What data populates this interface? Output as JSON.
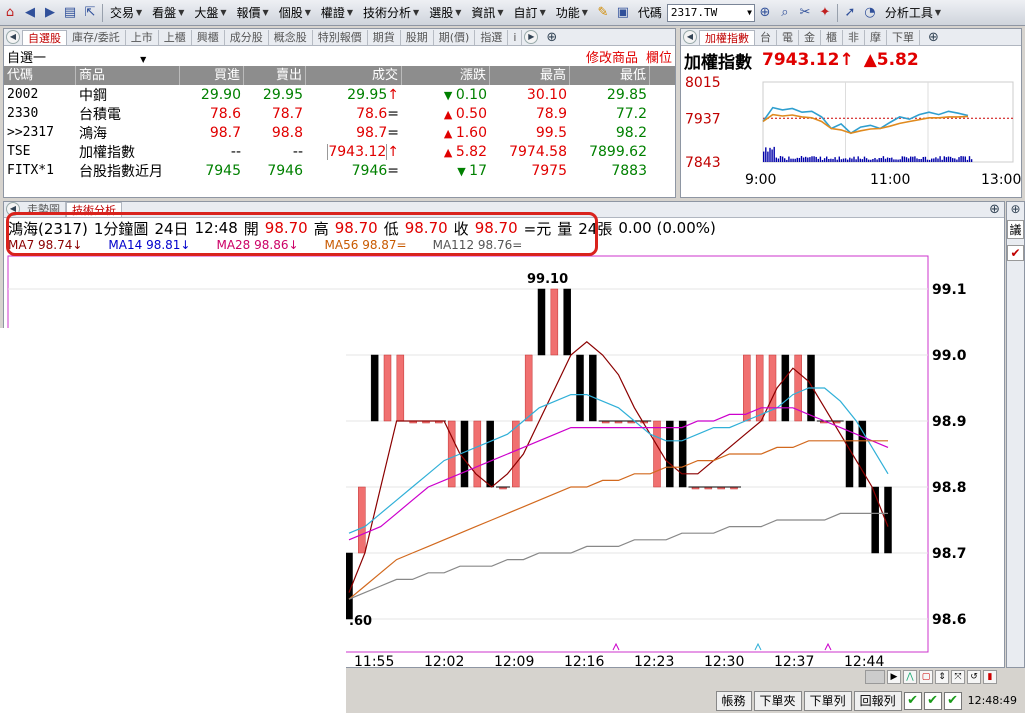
{
  "toolbar": {
    "menus": [
      "交易",
      "看盤",
      "大盤",
      "報價",
      "個股",
      "權證",
      "技術分析",
      "選股",
      "資訊",
      "自訂",
      "功能"
    ],
    "code_label": "代碼",
    "code_value": "2317.TW",
    "analysis_tools": "分析工具"
  },
  "quote_panel": {
    "tabs": [
      "自選股",
      "庫存/委託",
      "上市",
      "上櫃",
      "興櫃",
      "成分股",
      "概念股",
      "特別報價",
      "期貨",
      "股期",
      "期(價)",
      "指選",
      "i"
    ],
    "active_tab": "自選股",
    "list_name": "自選一",
    "modify_label": "修改商品",
    "column_label": "欄位",
    "headers": [
      "代碼",
      "商品",
      "買進",
      "賣出",
      "成交",
      "漲跌",
      "最高",
      "最低"
    ],
    "rows": [
      {
        "code": "2002",
        "name": "中鋼",
        "bid": "29.90",
        "ask": "29.95",
        "last": "29.95",
        "last_mark": "↑",
        "chg": "0.10",
        "dir": "down",
        "hi": "30.10",
        "lo": "29.85"
      },
      {
        "code": "2330",
        "name": "台積電",
        "bid": "78.6",
        "ask": "78.7",
        "last": "78.6",
        "last_mark": "=",
        "chg": "0.50",
        "dir": "up",
        "hi": "78.9",
        "lo": "77.2"
      },
      {
        "code": ">>2317",
        "name": "鴻海",
        "bid": "98.7",
        "ask": "98.8",
        "last": "98.7",
        "last_mark": "=",
        "chg": "1.60",
        "dir": "up",
        "hi": "99.5",
        "lo": "98.2"
      },
      {
        "code": "TSE",
        "name": "加權指數",
        "bid": "--",
        "ask": "--",
        "last": "7943.12",
        "last_mark": "↑",
        "chg": "5.82",
        "dir": "up",
        "hi": "7974.58",
        "lo": "7899.62"
      },
      {
        "code": "FITX*1",
        "name": "台股指數近月",
        "bid": "7945",
        "ask": "7946",
        "last": "7946",
        "last_mark": "=",
        "chg": "17",
        "dir": "down",
        "hi": "7975",
        "lo": "7883"
      }
    ]
  },
  "index_panel": {
    "tabs": [
      "加權指數",
      "台",
      "電",
      "金",
      "櫃",
      "非",
      "摩",
      "下單"
    ],
    "title": "加權指數",
    "value": "7943.12",
    "value_mark": "↑",
    "change": "5.82",
    "change_mark": "▲",
    "y_labels": [
      "8015",
      "7937",
      "7843"
    ],
    "x_labels": [
      "9:00",
      "11:00",
      "13:00"
    ],
    "chart_data": {
      "type": "line",
      "ylim": [
        7843,
        8015
      ],
      "x": [
        "9:00",
        "11:00",
        "13:00"
      ],
      "y_ticks": [
        8015,
        7937,
        7843
      ],
      "series": [
        {
          "color": "#2f9fcf",
          "values": [
            7930,
            7960,
            7955,
            7958,
            7950,
            7952,
            7940,
            7915,
            7925,
            7905,
            7918,
            7922,
            7915,
            7928,
            7940,
            7935,
            7945,
            7950,
            7945,
            7952,
            7948,
            7943
          ]
        },
        {
          "color": "#e08a1e",
          "values": [
            7930,
            7945,
            7942,
            7944,
            7940,
            7938,
            7930,
            7915,
            7912,
            7905,
            7910,
            7914,
            7915,
            7920,
            7926,
            7930,
            7934,
            7938,
            7938,
            7940,
            7940,
            7941
          ]
        }
      ]
    }
  },
  "tech_panel": {
    "tabs": [
      "走勢圖",
      "技術分析"
    ],
    "active_tab": "技術分析",
    "stock": "鴻海(2317)",
    "period": "1分鐘圖",
    "date": "24日",
    "time": "12:48",
    "open_label": "開",
    "open": "98.70",
    "high_label": "高",
    "high": "98.70",
    "low_label": "低",
    "low": "98.70",
    "close_label": "收",
    "close": "98.70",
    "change_text": "=元",
    "volume_label": "量",
    "volume": "24張",
    "change": "0.00 (0.00%)",
    "ma": [
      {
        "label": "MA7 98.74↓",
        "color": "#8b0000"
      },
      {
        "label": "MA14 98.81↓",
        "color": "#0000cc"
      },
      {
        "label": "MA28 98.86↓",
        "color": "#cc0066"
      },
      {
        "label": "MA56 98.87=",
        "color": "#c85a00"
      },
      {
        "label": "MA112 98.76=",
        "color": "#555555"
      }
    ],
    "chart_data": {
      "type": "bar",
      "ylim": [
        98.55,
        99.15
      ],
      "y_ticks": [
        98.6,
        98.7,
        98.8,
        98.9,
        99.0,
        99.1
      ],
      "x_ticks": [
        "11:55",
        "12:02",
        "12:09",
        "12:16",
        "12:23",
        "12:30",
        "12:37",
        "12:44"
      ],
      "high_annotation": "99.10",
      "low_annotation": ".60",
      "candles": [
        {
          "o": 98.6,
          "c": 98.7,
          "up": false
        },
        {
          "o": 98.7,
          "c": 98.8,
          "up": true
        },
        {
          "o": 99.0,
          "c": 98.9,
          "up": false
        },
        {
          "o": 98.9,
          "c": 99.0,
          "up": true
        },
        {
          "o": 98.9,
          "c": 99.0,
          "up": true
        },
        {
          "o": 98.9,
          "c": 98.9,
          "up": true
        },
        {
          "o": 98.9,
          "c": 98.9,
          "up": true
        },
        {
          "o": 98.9,
          "c": 98.9,
          "up": true
        },
        {
          "o": 98.8,
          "c": 98.9,
          "up": true
        },
        {
          "o": 98.9,
          "c": 98.8,
          "up": false
        },
        {
          "o": 98.8,
          "c": 98.9,
          "up": true
        },
        {
          "o": 98.9,
          "c": 98.8,
          "up": false
        },
        {
          "o": 98.8,
          "c": 98.8,
          "up": true
        },
        {
          "o": 98.8,
          "c": 98.9,
          "up": true
        },
        {
          "o": 98.9,
          "c": 99.0,
          "up": true
        },
        {
          "o": 99.0,
          "c": 99.1,
          "up": false
        },
        {
          "o": 99.0,
          "c": 99.1,
          "up": true
        },
        {
          "o": 99.1,
          "c": 99.0,
          "up": false
        },
        {
          "o": 99.0,
          "c": 98.9,
          "up": false
        },
        {
          "o": 98.9,
          "c": 99.0,
          "up": false
        },
        {
          "o": 98.9,
          "c": 98.9,
          "up": true
        },
        {
          "o": 98.9,
          "c": 98.9,
          "up": true
        },
        {
          "o": 98.9,
          "c": 98.9,
          "up": true
        },
        {
          "o": 98.9,
          "c": 98.9,
          "up": true
        },
        {
          "o": 98.8,
          "c": 98.9,
          "up": true
        },
        {
          "o": 98.8,
          "c": 98.9,
          "up": false
        },
        {
          "o": 98.9,
          "c": 98.8,
          "up": false
        },
        {
          "o": 98.8,
          "c": 98.8,
          "up": true
        },
        {
          "o": 98.8,
          "c": 98.8,
          "up": true
        },
        {
          "o": 98.8,
          "c": 98.8,
          "up": true
        },
        {
          "o": 98.8,
          "c": 98.8,
          "up": true
        },
        {
          "o": 98.9,
          "c": 99.0,
          "up": true
        },
        {
          "o": 98.9,
          "c": 99.0,
          "up": true
        },
        {
          "o": 98.9,
          "c": 99.0,
          "up": true
        },
        {
          "o": 98.9,
          "c": 99.0,
          "up": false
        },
        {
          "o": 98.9,
          "c": 99.0,
          "up": true
        },
        {
          "o": 99.0,
          "c": 98.9,
          "up": false
        },
        {
          "o": 98.9,
          "c": 98.9,
          "up": true
        },
        {
          "o": 98.9,
          "c": 98.9,
          "up": true
        },
        {
          "o": 98.9,
          "c": 98.8,
          "up": false
        },
        {
          "o": 98.9,
          "c": 98.8,
          "up": false
        },
        {
          "o": 98.8,
          "c": 98.7,
          "up": false
        },
        {
          "o": 98.8,
          "c": 98.7,
          "up": false
        }
      ],
      "ma_series": [
        {
          "name": "MA7",
          "color": "#8b0000",
          "values": [
            98.64,
            98.7,
            98.8,
            98.9,
            98.9,
            98.9,
            98.9,
            98.85,
            98.82,
            98.8,
            98.82,
            98.85,
            98.9,
            98.95,
            99.0,
            99.02,
            99.0,
            98.97,
            98.92,
            98.88,
            98.84,
            98.82,
            98.82,
            98.84,
            98.86,
            98.88,
            98.9,
            98.95,
            98.98,
            98.96,
            98.92,
            98.88,
            98.84,
            98.8,
            98.74
          ]
        },
        {
          "name": "MA14",
          "color": "#30b0d8",
          "values": [
            98.73,
            98.74,
            98.76,
            98.78,
            98.8,
            98.82,
            98.84,
            98.85,
            98.86,
            98.87,
            98.88,
            98.9,
            98.92,
            98.93,
            98.94,
            98.94,
            98.93,
            98.92,
            98.9,
            98.88,
            98.87,
            98.87,
            98.88,
            98.89,
            98.89,
            98.9,
            98.91,
            98.92,
            98.94,
            98.95,
            98.95,
            98.93,
            98.9,
            98.86,
            98.82
          ]
        },
        {
          "name": "MA28",
          "color": "#cc00cc",
          "values": [
            98.72,
            98.73,
            98.74,
            98.76,
            98.78,
            98.8,
            98.81,
            98.82,
            98.83,
            98.84,
            98.85,
            98.86,
            98.87,
            98.88,
            98.89,
            98.89,
            98.89,
            98.89,
            98.89,
            98.89,
            98.89,
            98.89,
            98.9,
            98.9,
            98.91,
            98.91,
            98.92,
            98.92,
            98.92,
            98.91,
            98.9,
            98.89,
            98.88,
            98.87,
            98.86
          ]
        },
        {
          "name": "MA56",
          "color": "#d2691e",
          "values": [
            98.63,
            98.65,
            98.67,
            98.69,
            98.7,
            98.71,
            98.72,
            98.73,
            98.74,
            98.75,
            98.76,
            98.77,
            98.78,
            98.79,
            98.8,
            98.8,
            98.81,
            98.81,
            98.82,
            98.82,
            98.83,
            98.83,
            98.84,
            98.84,
            98.85,
            98.85,
            98.85,
            98.86,
            98.86,
            98.87,
            98.87,
            98.87,
            98.87,
            98.87,
            98.87
          ]
        },
        {
          "name": "MA112",
          "color": "#888888",
          "values": [
            98.63,
            98.64,
            98.65,
            98.66,
            98.66,
            98.67,
            98.67,
            98.68,
            98.68,
            98.68,
            98.69,
            98.69,
            98.7,
            98.7,
            98.7,
            98.71,
            98.71,
            98.71,
            98.72,
            98.72,
            98.72,
            98.73,
            98.73,
            98.73,
            98.74,
            98.74,
            98.74,
            98.75,
            98.75,
            98.75,
            98.75,
            98.76,
            98.76,
            98.76,
            98.76
          ]
        }
      ]
    }
  },
  "statusbar": {
    "buttons": [
      "帳務",
      "下單夾",
      "下單列",
      "回報列"
    ],
    "time": "12:48:49"
  },
  "side": {
    "label": "議"
  }
}
